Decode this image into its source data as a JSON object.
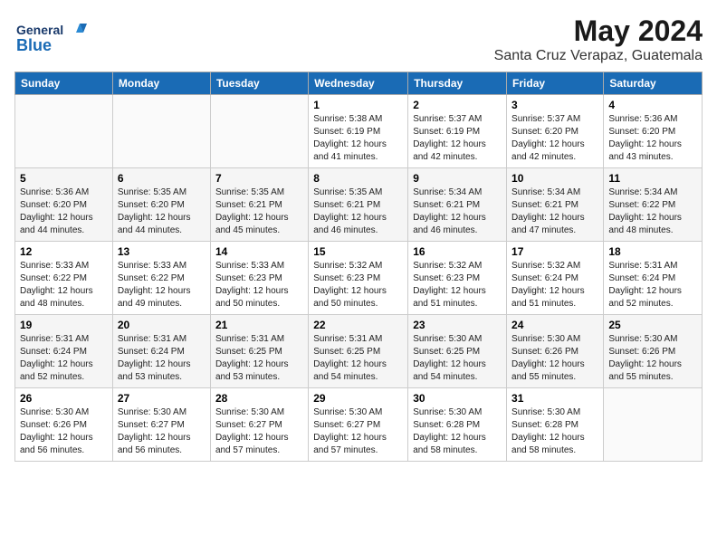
{
  "logo": {
    "line1": "General",
    "line2": "Blue"
  },
  "title": "May 2024",
  "location": "Santa Cruz Verapaz, Guatemala",
  "days_of_week": [
    "Sunday",
    "Monday",
    "Tuesday",
    "Wednesday",
    "Thursday",
    "Friday",
    "Saturday"
  ],
  "weeks": [
    [
      {
        "num": "",
        "info": ""
      },
      {
        "num": "",
        "info": ""
      },
      {
        "num": "",
        "info": ""
      },
      {
        "num": "1",
        "info": "Sunrise: 5:38 AM\nSunset: 6:19 PM\nDaylight: 12 hours\nand 41 minutes."
      },
      {
        "num": "2",
        "info": "Sunrise: 5:37 AM\nSunset: 6:19 PM\nDaylight: 12 hours\nand 42 minutes."
      },
      {
        "num": "3",
        "info": "Sunrise: 5:37 AM\nSunset: 6:20 PM\nDaylight: 12 hours\nand 42 minutes."
      },
      {
        "num": "4",
        "info": "Sunrise: 5:36 AM\nSunset: 6:20 PM\nDaylight: 12 hours\nand 43 minutes."
      }
    ],
    [
      {
        "num": "5",
        "info": "Sunrise: 5:36 AM\nSunset: 6:20 PM\nDaylight: 12 hours\nand 44 minutes."
      },
      {
        "num": "6",
        "info": "Sunrise: 5:35 AM\nSunset: 6:20 PM\nDaylight: 12 hours\nand 44 minutes."
      },
      {
        "num": "7",
        "info": "Sunrise: 5:35 AM\nSunset: 6:21 PM\nDaylight: 12 hours\nand 45 minutes."
      },
      {
        "num": "8",
        "info": "Sunrise: 5:35 AM\nSunset: 6:21 PM\nDaylight: 12 hours\nand 46 minutes."
      },
      {
        "num": "9",
        "info": "Sunrise: 5:34 AM\nSunset: 6:21 PM\nDaylight: 12 hours\nand 46 minutes."
      },
      {
        "num": "10",
        "info": "Sunrise: 5:34 AM\nSunset: 6:21 PM\nDaylight: 12 hours\nand 47 minutes."
      },
      {
        "num": "11",
        "info": "Sunrise: 5:34 AM\nSunset: 6:22 PM\nDaylight: 12 hours\nand 48 minutes."
      }
    ],
    [
      {
        "num": "12",
        "info": "Sunrise: 5:33 AM\nSunset: 6:22 PM\nDaylight: 12 hours\nand 48 minutes."
      },
      {
        "num": "13",
        "info": "Sunrise: 5:33 AM\nSunset: 6:22 PM\nDaylight: 12 hours\nand 49 minutes."
      },
      {
        "num": "14",
        "info": "Sunrise: 5:33 AM\nSunset: 6:23 PM\nDaylight: 12 hours\nand 50 minutes."
      },
      {
        "num": "15",
        "info": "Sunrise: 5:32 AM\nSunset: 6:23 PM\nDaylight: 12 hours\nand 50 minutes."
      },
      {
        "num": "16",
        "info": "Sunrise: 5:32 AM\nSunset: 6:23 PM\nDaylight: 12 hours\nand 51 minutes."
      },
      {
        "num": "17",
        "info": "Sunrise: 5:32 AM\nSunset: 6:24 PM\nDaylight: 12 hours\nand 51 minutes."
      },
      {
        "num": "18",
        "info": "Sunrise: 5:31 AM\nSunset: 6:24 PM\nDaylight: 12 hours\nand 52 minutes."
      }
    ],
    [
      {
        "num": "19",
        "info": "Sunrise: 5:31 AM\nSunset: 6:24 PM\nDaylight: 12 hours\nand 52 minutes."
      },
      {
        "num": "20",
        "info": "Sunrise: 5:31 AM\nSunset: 6:24 PM\nDaylight: 12 hours\nand 53 minutes."
      },
      {
        "num": "21",
        "info": "Sunrise: 5:31 AM\nSunset: 6:25 PM\nDaylight: 12 hours\nand 53 minutes."
      },
      {
        "num": "22",
        "info": "Sunrise: 5:31 AM\nSunset: 6:25 PM\nDaylight: 12 hours\nand 54 minutes."
      },
      {
        "num": "23",
        "info": "Sunrise: 5:30 AM\nSunset: 6:25 PM\nDaylight: 12 hours\nand 54 minutes."
      },
      {
        "num": "24",
        "info": "Sunrise: 5:30 AM\nSunset: 6:26 PM\nDaylight: 12 hours\nand 55 minutes."
      },
      {
        "num": "25",
        "info": "Sunrise: 5:30 AM\nSunset: 6:26 PM\nDaylight: 12 hours\nand 55 minutes."
      }
    ],
    [
      {
        "num": "26",
        "info": "Sunrise: 5:30 AM\nSunset: 6:26 PM\nDaylight: 12 hours\nand 56 minutes."
      },
      {
        "num": "27",
        "info": "Sunrise: 5:30 AM\nSunset: 6:27 PM\nDaylight: 12 hours\nand 56 minutes."
      },
      {
        "num": "28",
        "info": "Sunrise: 5:30 AM\nSunset: 6:27 PM\nDaylight: 12 hours\nand 57 minutes."
      },
      {
        "num": "29",
        "info": "Sunrise: 5:30 AM\nSunset: 6:27 PM\nDaylight: 12 hours\nand 57 minutes."
      },
      {
        "num": "30",
        "info": "Sunrise: 5:30 AM\nSunset: 6:28 PM\nDaylight: 12 hours\nand 58 minutes."
      },
      {
        "num": "31",
        "info": "Sunrise: 5:30 AM\nSunset: 6:28 PM\nDaylight: 12 hours\nand 58 minutes."
      },
      {
        "num": "",
        "info": ""
      }
    ]
  ]
}
